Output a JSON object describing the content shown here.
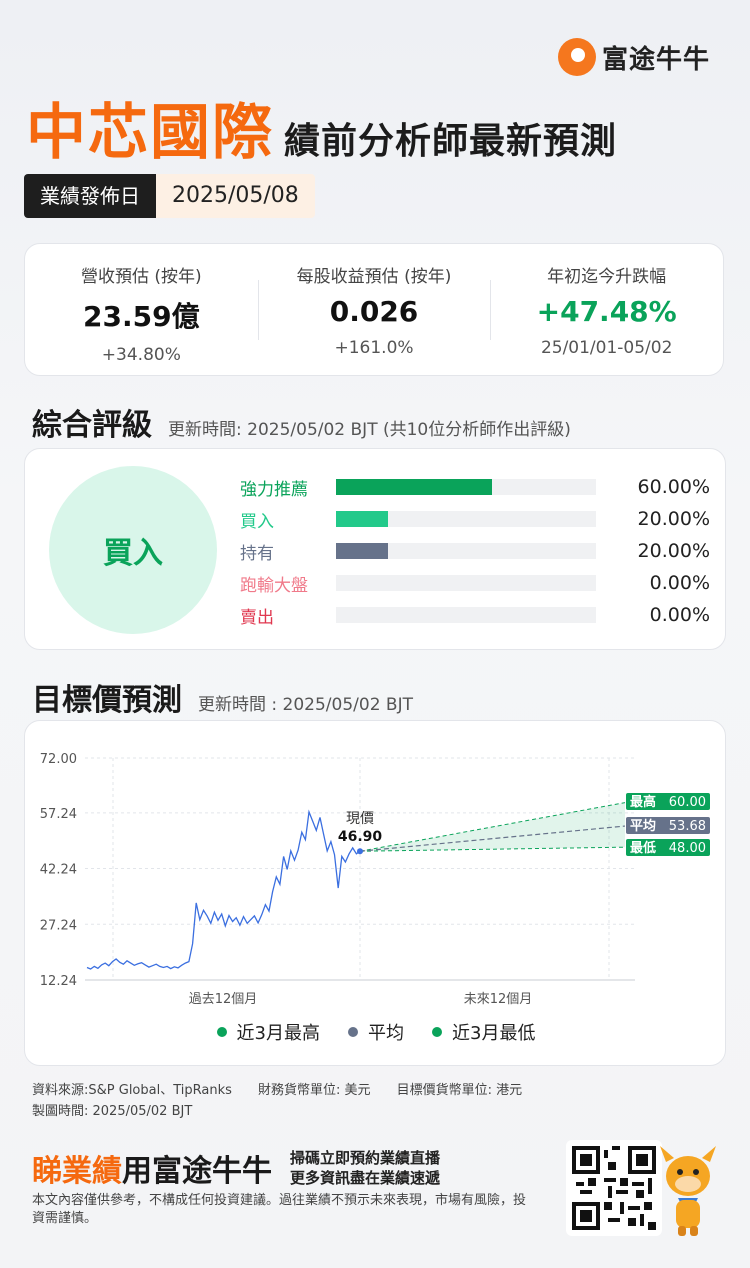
{
  "brand": {
    "name": "富途牛牛",
    "icon": "futu-logo-icon"
  },
  "title": {
    "company": "中芯國際",
    "subtitle": "績前分析師最新預測"
  },
  "release": {
    "label": "業績發佈日",
    "date": "2025/05/08"
  },
  "stats": [
    {
      "label": "營收預估 (按年)",
      "value": "23.59億",
      "sub": "+34.80%"
    },
    {
      "label": "每股收益預估 (按年)",
      "value": "0.026",
      "sub": "+161.0%"
    },
    {
      "label": "年初迄今升跌幅",
      "value": "+47.48%",
      "sub": "25/01/01-05/02"
    }
  ],
  "rating": {
    "title": "綜合評級",
    "updated": "更新時間: 2025/05/02 BJT (共10位分析師作出評級)",
    "overall": "買入",
    "items": [
      {
        "name": "強力推薦",
        "pct_label": "60.00%",
        "pct": 60,
        "color": "#0aa35a"
      },
      {
        "name": "買入",
        "pct_label": "20.00%",
        "pct": 20,
        "color": "#22c98a"
      },
      {
        "name": "持有",
        "pct_label": "20.00%",
        "pct": 20,
        "color": "#66728a"
      },
      {
        "name": "跑輸大盤",
        "pct_label": "0.00%",
        "pct": 0,
        "color": "#f07a8a"
      },
      {
        "name": "賣出",
        "pct_label": "0.00%",
        "pct": 0,
        "color": "#e0374f"
      }
    ]
  },
  "target": {
    "title": "目標價預測",
    "updated": "更新時間 : 2025/05/02 BJT",
    "legend": [
      "近3月最高",
      "平均",
      "近3月最低"
    ]
  },
  "chart_data": {
    "type": "line",
    "y_ticks": [
      "72.00",
      "57.24",
      "42.24",
      "27.24",
      "12.24"
    ],
    "ylim": [
      12.24,
      72.0
    ],
    "x_labels": [
      "過去12個月",
      "未來12個月"
    ],
    "current": {
      "label": "現價",
      "value": 46.9,
      "value_label": "46.90"
    },
    "forecast": [
      {
        "name": "最高",
        "value": 60.0,
        "value_label": "60.00",
        "color": "#0aa35a"
      },
      {
        "name": "平均",
        "value": 53.68,
        "value_label": "53.68",
        "color": "#66728a"
      },
      {
        "name": "最低",
        "value": 48.0,
        "value_label": "48.00",
        "color": "#0aa35a"
      }
    ],
    "price_series": [
      15.6,
      15.2,
      15.9,
      15.4,
      16.3,
      16.8,
      16.1,
      17.2,
      17.9,
      17.0,
      16.5,
      17.4,
      16.8,
      16.2,
      16.6,
      16.9,
      16.3,
      15.7,
      16.1,
      16.5,
      15.9,
      15.6,
      15.9,
      15.3,
      15.8,
      15.5,
      16.2,
      16.8,
      17.2,
      22.0,
      33.0,
      28.5,
      31.0,
      29.5,
      27.5,
      30.5,
      28.3,
      30.0,
      26.8,
      29.6,
      28.0,
      29.0,
      27.0,
      29.3,
      27.5,
      28.5,
      29.5,
      27.6,
      29.8,
      32.5,
      30.8,
      36.0,
      40.0,
      38.0,
      45.5,
      42.0,
      47.0,
      44.5,
      47.2,
      52.0,
      50.0,
      57.5,
      55.0,
      52.5,
      56.0,
      51.5,
      47.0,
      49.5,
      46.0,
      37.0,
      45.5,
      44.0,
      46.2,
      47.8,
      46.2,
      46.9
    ]
  },
  "footer": {
    "source": "資料來源:S&P Global、TipRanks",
    "fin_currency": "財務貨幣單位: 美元",
    "target_currency": "目標價貨幣單位: 港元",
    "made": "製圖時間: 2025/05/02 BJT",
    "promo_orange": "睇業績",
    "promo_dark": "用富途牛牛",
    "promo_line1": "掃碼立即預約業績直播",
    "promo_line2": "更多資訊盡在業績速遞",
    "disclaimer": "本文內容僅供參考，不構成任何投資建議。過往業績不預示未來表現，市場有風險，投資需謹慎。"
  }
}
